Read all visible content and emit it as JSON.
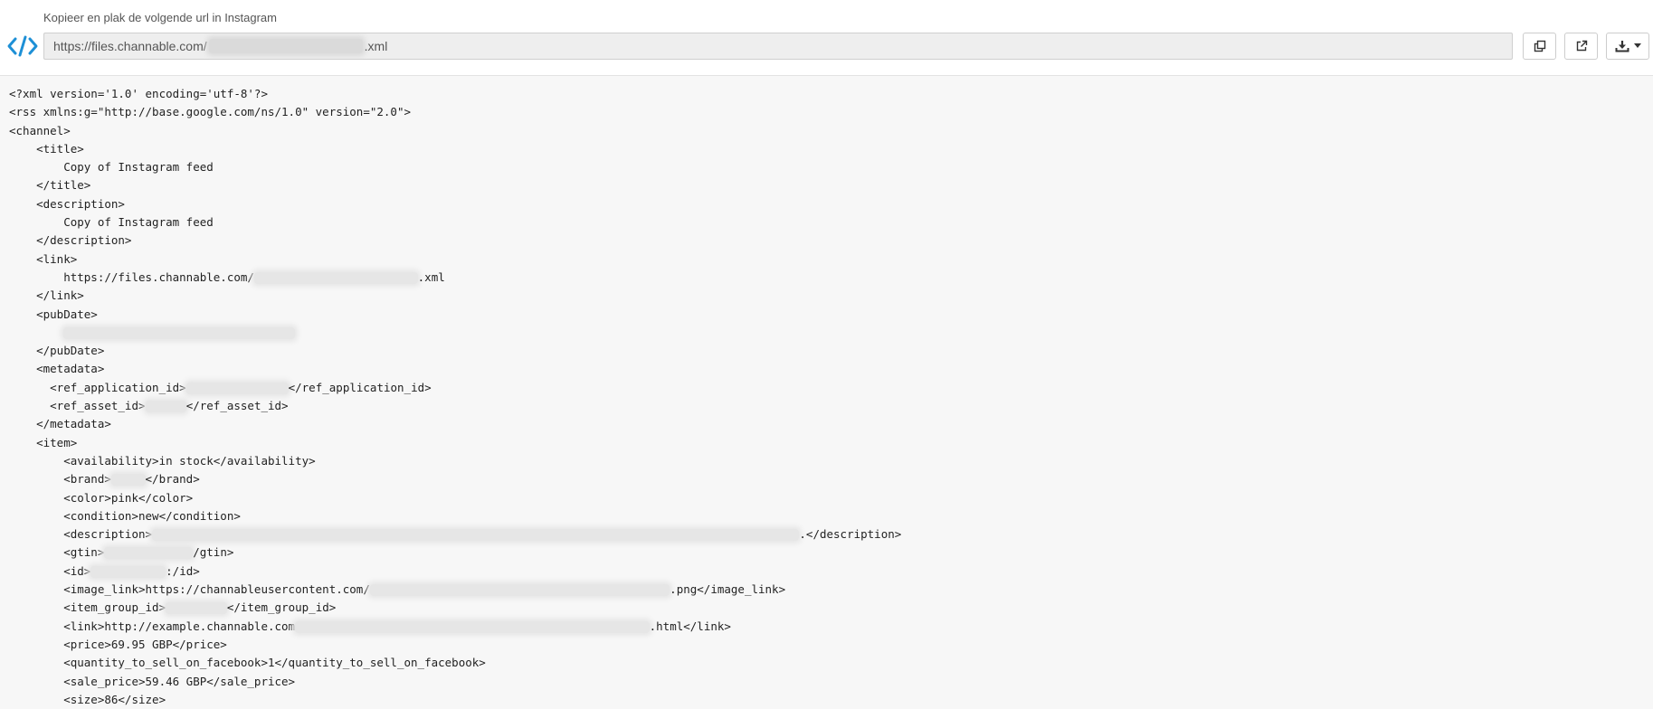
{
  "header": {
    "label": "Kopieer en plak de volgende url in Instagram",
    "url_prefix": "https://files.channable.com/",
    "url_suffix": ".xml"
  },
  "icons": {
    "code": "code-brackets-icon",
    "copy": "copy-icon",
    "open": "external-link-icon",
    "download": "download-icon",
    "dropdown": "caret-down-icon"
  },
  "colors": {
    "accent": "#1e90d6",
    "code_background": "#f7f7f7",
    "field_background": "#eeeeee"
  },
  "code": {
    "lines": [
      {
        "pre": "<?xml version='1.0' encoding='utf-8'?>"
      },
      {
        "pre": "<rss xmlns:g=\"http://base.google.com/ns/1.0\" version=\"2.0\">"
      },
      {
        "pre": "<channel>"
      },
      {
        "pre": "    <title>"
      },
      {
        "pre": "        Copy of Instagram feed"
      },
      {
        "pre": "    </title>"
      },
      {
        "pre": "    <description>"
      },
      {
        "pre": "        Copy of Instagram feed"
      },
      {
        "pre": "    </description>"
      },
      {
        "pre": "    <link>"
      },
      {
        "pre": "        https://files.channable.com/",
        "redact": 24,
        "post": ".xml"
      },
      {
        "pre": "    </link>"
      },
      {
        "pre": "    <pubDate>"
      },
      {
        "pre": "        ",
        "redact": 34
      },
      {
        "pre": "    </pubDate>"
      },
      {
        "pre": "    <metadata>"
      },
      {
        "pre": "      <ref_application_id>",
        "redact": 15,
        "post": "</ref_application_id>"
      },
      {
        "pre": "      <ref_asset_id>",
        "redact": 6,
        "post": "</ref_asset_id>"
      },
      {
        "pre": "    </metadata>"
      },
      {
        "pre": "    <item>"
      },
      {
        "pre": "        <availability>in stock</availability>"
      },
      {
        "pre": "        <brand>",
        "redact": 5,
        "post": "</brand>"
      },
      {
        "pre": "        <color>pink</color>"
      },
      {
        "pre": "        <condition>new</condition>"
      },
      {
        "pre": "        <description>",
        "redact": 95,
        "post": ".</description>"
      },
      {
        "pre": "        <gtin>",
        "redact": 13,
        "post": "/gtin>"
      },
      {
        "pre": "        <id>",
        "redact": 11,
        "post": ":/id>"
      },
      {
        "pre": "        <image_link>https://channableusercontent.com/",
        "redact": 44,
        "post": ".png</image_link>"
      },
      {
        "pre": "        <item_group_id>",
        "redact": 9,
        "post": "</item_group_id>"
      },
      {
        "pre": "        <link>http://example.channable.com",
        "redact": 52,
        "post": ".html</link>"
      },
      {
        "pre": "        <price>69.95 GBP</price>"
      },
      {
        "pre": "        <quantity_to_sell_on_facebook>1</quantity_to_sell_on_facebook>"
      },
      {
        "pre": "        <sale_price>59.46 GBP</sale_price>"
      },
      {
        "pre": "        <size>86</size>"
      }
    ]
  }
}
